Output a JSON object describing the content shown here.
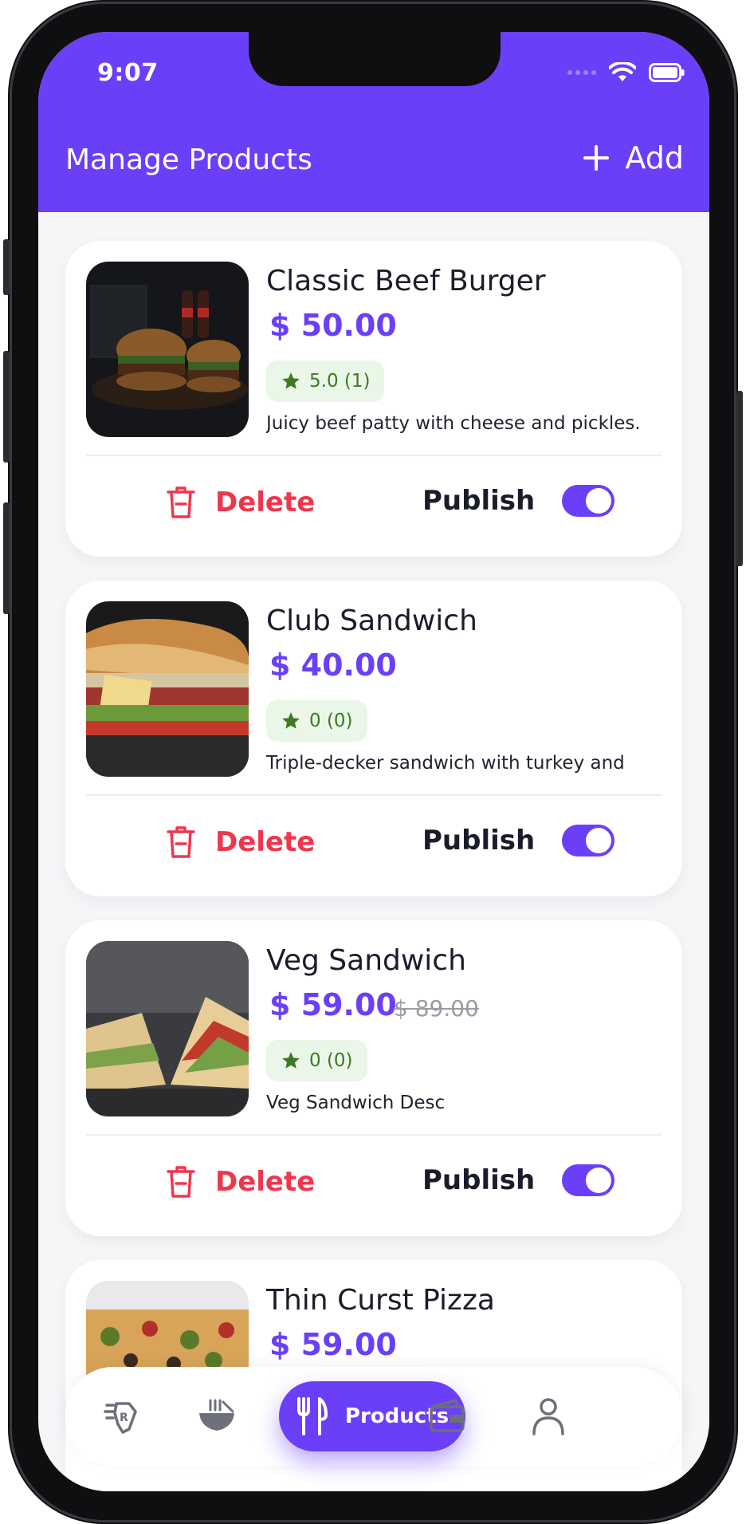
{
  "status_bar": {
    "time": "9:07"
  },
  "header": {
    "title": "Manage Products",
    "add_label": "Add"
  },
  "products": [
    {
      "name": "Classic Beef Burger",
      "price": "$ 50.00",
      "old_price": "",
      "rating": "5.0 (1)",
      "description": "Juicy beef patty with cheese and pickles.",
      "delete_label": "Delete",
      "publish_label": "Publish",
      "published": true,
      "image": "burger-photo"
    },
    {
      "name": "Club Sandwich",
      "price": "$ 40.00",
      "old_price": "",
      "rating": "0 (0)",
      "description": "Triple-decker sandwich with turkey and",
      "delete_label": "Delete",
      "publish_label": "Publish",
      "published": true,
      "image": "club-sandwich-photo"
    },
    {
      "name": "Veg Sandwich",
      "price": "$ 59.00",
      "old_price": "$ 89.00",
      "rating": "0 (0)",
      "description": "Veg Sandwich Desc",
      "delete_label": "Delete",
      "publish_label": "Publish",
      "published": true,
      "image": "veg-sandwich-photo"
    },
    {
      "name": "Thin Curst Pizza",
      "price": "$ 59.00",
      "old_price": "",
      "rating": "",
      "description": "",
      "delete_label": "",
      "publish_label": "",
      "published": true,
      "image": "pizza-photo"
    }
  ],
  "bottom_nav": {
    "items": [
      {
        "icon": "restaurant-badge-icon"
      },
      {
        "icon": "food-bowl-icon"
      },
      {
        "icon": "fork-knife-icon",
        "label": "Products",
        "active": true
      },
      {
        "icon": "wallet-icon"
      },
      {
        "icon": "profile-icon"
      }
    ]
  },
  "colors": {
    "brand": "#6b3ff8",
    "danger": "#f0364e",
    "rating_bg": "#eaf6e8",
    "rating_text": "#3d7a24"
  }
}
